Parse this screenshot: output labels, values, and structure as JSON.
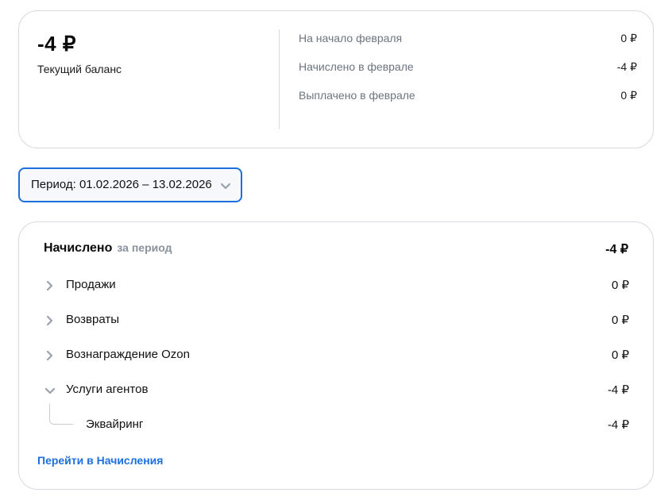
{
  "balance": {
    "amount": "-4 ₽",
    "label": "Текущий баланс",
    "summary": [
      {
        "label": "На начало февраля",
        "value": "0 ₽"
      },
      {
        "label": "Начислено в феврале",
        "value": "-4 ₽"
      },
      {
        "label": "Выплачено в феврале",
        "value": "0 ₽"
      }
    ]
  },
  "period": {
    "label": "Период: 01.02.2026 – 13.02.2026",
    "icon": "chevron-down-icon"
  },
  "accruals": {
    "title": "Начислено",
    "subtitle": "за период",
    "total": "-4 ₽",
    "rows": [
      {
        "name": "Продажи",
        "amount": "0 ₽",
        "expanded": false
      },
      {
        "name": "Возвраты",
        "amount": "0 ₽",
        "expanded": false
      },
      {
        "name": "Вознаграждение Ozon",
        "amount": "0 ₽",
        "expanded": false
      },
      {
        "name": "Услуги агентов",
        "amount": "-4 ₽",
        "expanded": true
      }
    ],
    "sub_rows": [
      {
        "name": "Эквайринг",
        "amount": "-4 ₽"
      }
    ],
    "link_label": "Перейти в Начисления"
  },
  "colors": {
    "accent": "#1d6fe0",
    "muted_text": "#6b7480",
    "border": "#d6d9de",
    "chevron": "#9aa1ab"
  }
}
